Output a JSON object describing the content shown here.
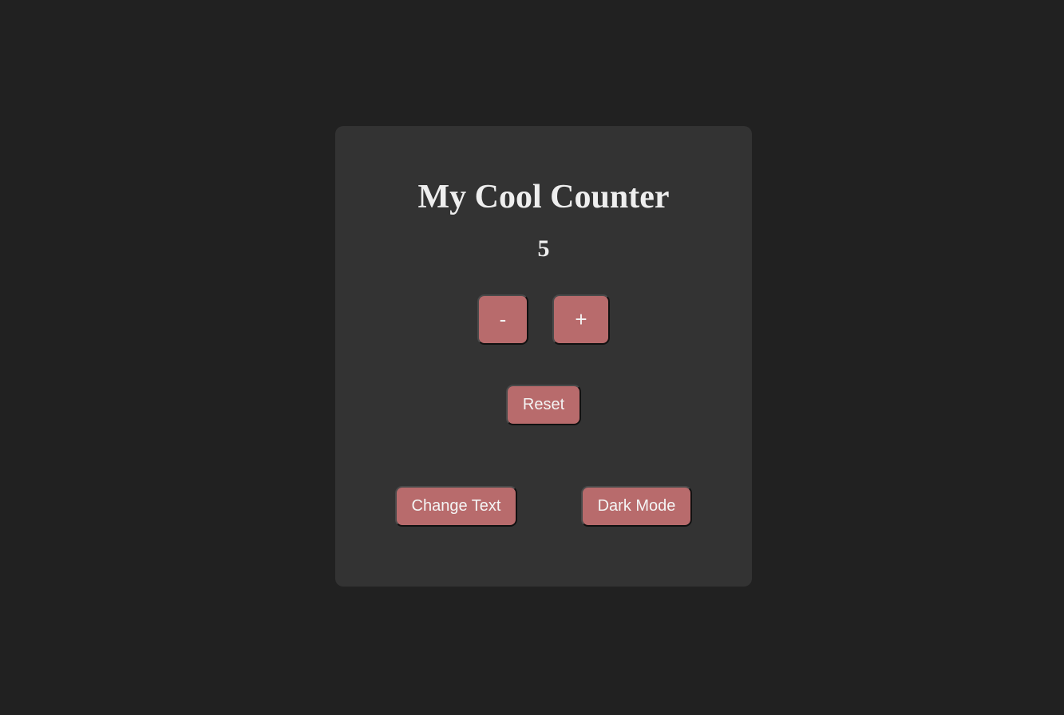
{
  "app": {
    "title": "My Cool Counter",
    "count": "5"
  },
  "buttons": {
    "decrement_label": "-",
    "increment_label": "+",
    "reset_label": "Reset",
    "change_text_label": "Change Text",
    "dark_mode_label": "Dark Mode"
  },
  "colors": {
    "page_background": "#212121",
    "card_background": "#333333",
    "button_background": "#b86b6c",
    "text": "#eeeeee"
  }
}
